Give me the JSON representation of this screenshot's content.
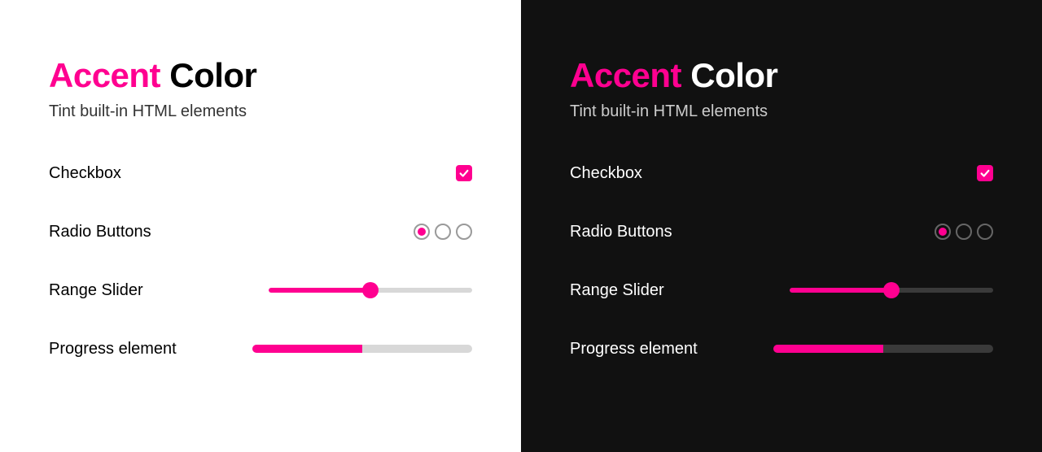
{
  "accent_color": "#ff0090",
  "title": {
    "word_accent": "Accent",
    "word_color": "Color"
  },
  "subtitle": "Tint built-in HTML elements",
  "rows": {
    "checkbox": {
      "label": "Checkbox",
      "checked": true
    },
    "radio": {
      "label": "Radio Buttons",
      "options": 3,
      "selected_index": 0
    },
    "range": {
      "label": "Range Slider",
      "value": 50,
      "min": 0,
      "max": 100
    },
    "progress": {
      "label": "Progress element",
      "value": 50,
      "max": 100
    }
  },
  "panels": [
    {
      "theme": "light"
    },
    {
      "theme": "dark"
    }
  ]
}
